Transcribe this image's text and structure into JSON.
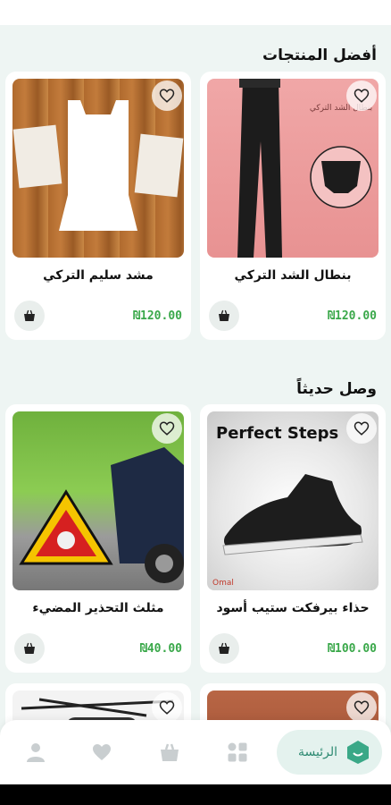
{
  "sections": {
    "best": "أفضل المنتجات",
    "new": "وصل حديثاً"
  },
  "products": [
    {
      "title": "بنطال الشد التركي",
      "price": "₪120.00",
      "image_text": "بنطال الشد التركي"
    },
    {
      "title": "مشد سليم التركي",
      "price": "₪120.00"
    },
    {
      "title": "حذاء بيرفكت ستيب أسود",
      "price": "₪100.00",
      "image_text": "Perfect Steps",
      "brand_mark": "Omal"
    },
    {
      "title": "مثلث التحذير المضيء",
      "price": "₪40.00"
    }
  ],
  "nav": {
    "home": "الرئيسة"
  },
  "icons": [
    "heart-icon",
    "basket-icon",
    "user-icon",
    "grid-icon",
    "home-icon"
  ],
  "colors": {
    "price": "#3aa84a",
    "home_accent": "#2e8a72",
    "home_pill": "#e4f2ee",
    "background": "#eef5f3"
  }
}
